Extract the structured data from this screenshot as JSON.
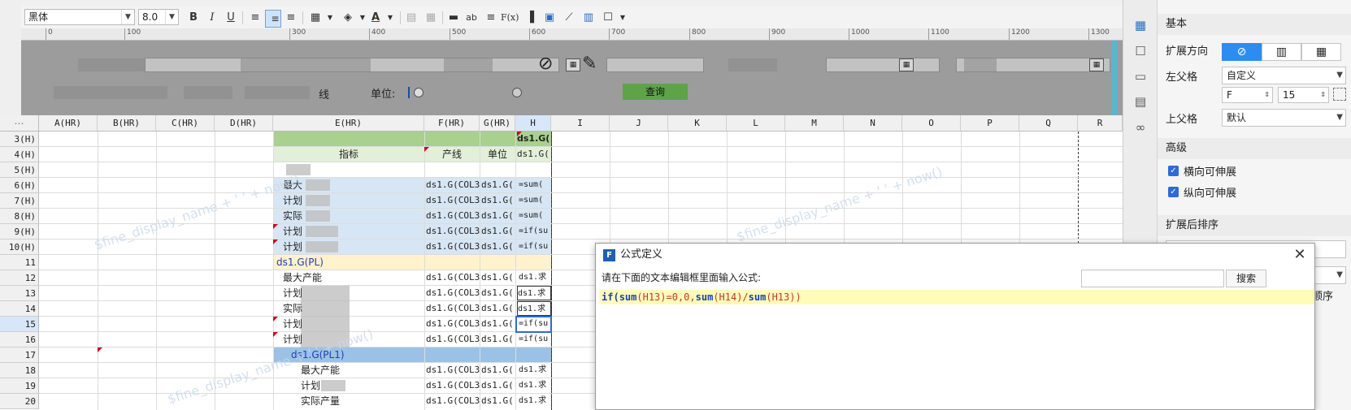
{
  "toolbar": {
    "font_name": "黑体",
    "font_size": "8.0",
    "bold": "B",
    "italic": "I",
    "underline": "U",
    "fx": "F(x)",
    "ab": "ab"
  },
  "ruler": {
    "ticks": [
      "0",
      "100",
      "300",
      "400",
      "500",
      "600",
      "700",
      "800",
      "900",
      "1000",
      "1100",
      "1200",
      "1300"
    ]
  },
  "param_panel": {
    "unit_label": "单位:",
    "query_button": "查询",
    "line_label": "线"
  },
  "grid": {
    "columns": [
      "A(HR)",
      "B(HR)",
      "C(HR)",
      "D(HR)",
      "E(HR)",
      "F(HR)",
      "G(HR)",
      "H",
      "I",
      "J",
      "K",
      "L",
      "M",
      "N",
      "O",
      "P",
      "Q",
      "R"
    ],
    "rows": [
      "3(H)",
      "4(H)",
      "5(H)",
      "6(H)",
      "7(H)",
      "8(H)",
      "9(H)",
      "10(H)",
      "11",
      "12",
      "13",
      "14",
      "15",
      "16",
      "17",
      "18",
      "19",
      "20"
    ],
    "cells": {
      "h3": "ds1.G(",
      "e4": "指标",
      "f4": "产线",
      "g4": "单位",
      "h4": "ds1.G(",
      "e6": "最大",
      "e7": "计划",
      "e8": "实际",
      "e9": "计划",
      "e10": "计划",
      "e11": "ds1.G(PL)",
      "e12": "最大产能",
      "e13": "计划",
      "e14": "实际",
      "e15": "计划",
      "e16": "计划",
      "e17": "ds1.G(PL1)",
      "e18": "最大产能",
      "e19": "计划",
      "e20": "实际产量",
      "f_col3": "ds1.G(COL3",
      "g_col": "ds1.G(",
      "h_sum": "=sum(",
      "h_if": "=if(su",
      "h_ds": "ds1.求"
    },
    "watermark": "$fine_display_name + ' ' + now()"
  },
  "right_panel": {
    "basic": "基本",
    "expand_dir": "扩展方向",
    "left_parent": "左父格",
    "left_parent_value": "自定义",
    "left_col": "F",
    "left_row": "15",
    "top_parent": "上父格",
    "top_parent_value": "默认",
    "advanced": "高级",
    "horiz_expand": "横向可伸展",
    "vert_expand": "纵向可伸展",
    "post_sort": "扩展后排序",
    "order_suffix": "顺序"
  },
  "dialog": {
    "title": "公式定义",
    "prompt": "请在下面的文本编辑框里面输入公式:",
    "search_button": "搜索",
    "formula_kw1": "if(",
    "formula_kw2": "sum",
    "formula_p1": "(H13)=0,0,",
    "formula_kw3": "sum",
    "formula_p2": "(H14)/",
    "formula_kw4": "sum",
    "formula_p3": "(H13))"
  }
}
